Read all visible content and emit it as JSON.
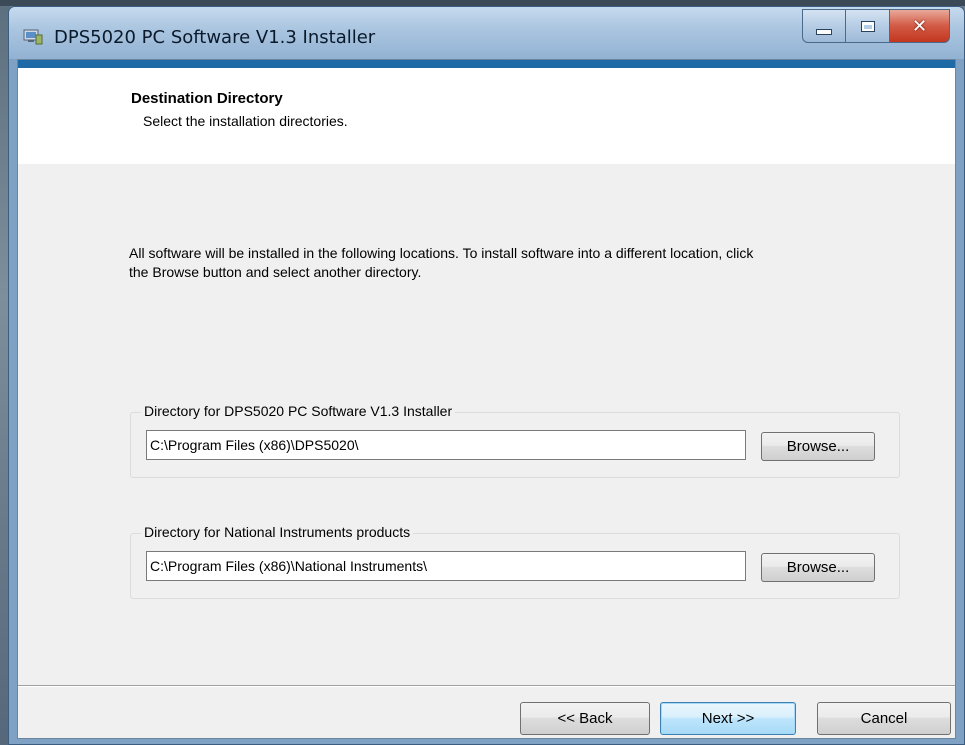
{
  "window": {
    "title": "DPS5020 PC Software V1.3 Installer"
  },
  "header": {
    "title": "Destination Directory",
    "subtitle": "Select the installation directories."
  },
  "intro_text": "All software will be installed in the following locations. To install software into a different location, click the Browse button and select another directory.",
  "groups": [
    {
      "legend": "Directory for DPS5020 PC Software V1.3 Installer",
      "path": "C:\\Program Files (x86)\\DPS5020\\",
      "browse_label": "Browse..."
    },
    {
      "legend": "Directory for National Instruments products",
      "path": "C:\\Program Files (x86)\\National Instruments\\",
      "browse_label": "Browse..."
    }
  ],
  "footer": {
    "back_label": "<< Back",
    "next_label": "Next >>",
    "cancel_label": "Cancel"
  },
  "colors": {
    "accent_strip": "#1e6aa6",
    "close_button": "#c3361e",
    "dialog_bg": "#f0f0f0"
  },
  "icons": [
    "installer-icon",
    "minimize-icon",
    "maximize-icon",
    "close-icon"
  ]
}
